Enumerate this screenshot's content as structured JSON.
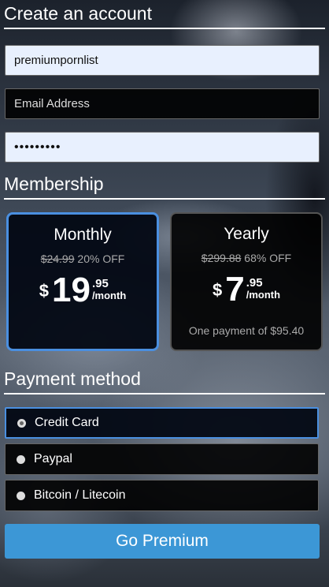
{
  "account": {
    "title": "Create an account",
    "username_value": "premiumpornlist",
    "email_placeholder": "Email Address",
    "password_masked": "•••••••••"
  },
  "membership": {
    "title": "Membership",
    "plans": [
      {
        "name": "Monthly",
        "old_price": "$24.99",
        "discount": "20% OFF",
        "currency": "$",
        "price_whole": "19",
        "price_cents": ".95",
        "period": "/month",
        "note": "",
        "selected": true
      },
      {
        "name": "Yearly",
        "old_price": "$299.88",
        "discount": "68% OFF",
        "currency": "$",
        "price_whole": "7",
        "price_cents": ".95",
        "period": "/month",
        "note": "One payment of $95.40",
        "selected": false
      }
    ]
  },
  "payment": {
    "title": "Payment method",
    "options": [
      {
        "label": "Credit Card",
        "selected": true
      },
      {
        "label": "Paypal",
        "selected": false
      },
      {
        "label": "Bitcoin / Litecoin",
        "selected": false
      }
    ]
  },
  "submit_label": "Go Premium",
  "colors": {
    "accent": "#4a8fe0",
    "button": "#3c97d6"
  }
}
